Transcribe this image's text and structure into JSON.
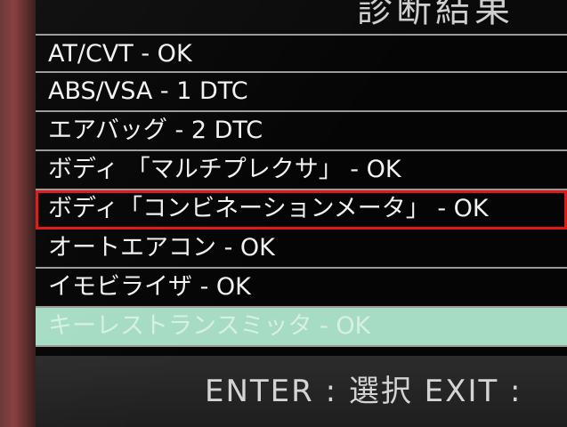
{
  "header": {
    "title": "診断結果"
  },
  "items": [
    {
      "label": "AT/CVT - OK"
    },
    {
      "label": "ABS/VSA - 1 DTC"
    },
    {
      "label": "エアバッグ - 2 DTC"
    },
    {
      "label": "ボディ 「マルチプレクサ」 - OK"
    },
    {
      "label": "ボディ「コンビネーションメータ」 - OK"
    },
    {
      "label": "オートエアコン - OK"
    },
    {
      "label": "イモビライザ - OK"
    },
    {
      "label": "キーレストランスミッタ - OK"
    }
  ],
  "footer": {
    "hint": "ENTER : 選択 EXIT :"
  },
  "colors": {
    "selected_row": "#a6dcc4",
    "highlight_box": "#e01818",
    "row_divider": "#9a9a9a"
  }
}
